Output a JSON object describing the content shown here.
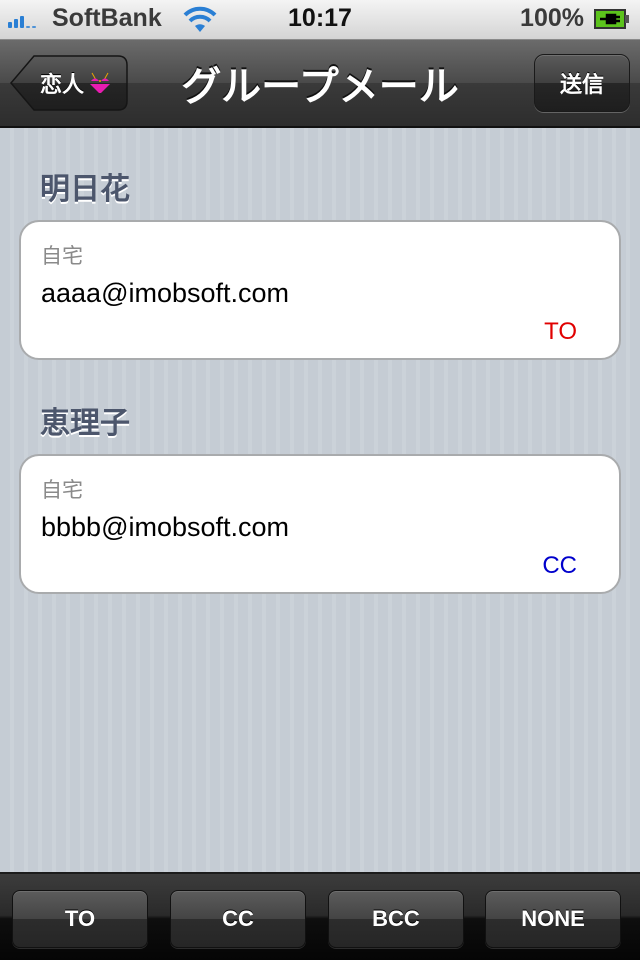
{
  "status_bar": {
    "carrier": "SoftBank",
    "time": "10:17",
    "battery_percent": "100%",
    "signal_bars_active": 3,
    "signal_bars_total": 5,
    "battery_level": 1.0,
    "charging": true
  },
  "nav_bar": {
    "back_label": "恋人",
    "back_icon": "bikini-icon",
    "title": "グループメール",
    "send_label": "送信"
  },
  "contacts": [
    {
      "name": "明日花",
      "type_label": "自宅",
      "email": "aaaa@imobsoft.com",
      "mode": "TO",
      "mode_color": "#e00000"
    },
    {
      "name": "恵理子",
      "type_label": "自宅",
      "email": "bbbb@imobsoft.com",
      "mode": "CC",
      "mode_color": "#0000cc"
    }
  ],
  "toolbar": {
    "buttons": [
      {
        "label": "TO"
      },
      {
        "label": "CC"
      },
      {
        "label": "BCC"
      },
      {
        "label": "NONE"
      }
    ]
  },
  "colors": {
    "accent_to": "#e00000",
    "accent_cc": "#0000cc",
    "section_header": "#4c566c",
    "signal": "#2a7fd4",
    "battery": "#5cc31c"
  }
}
